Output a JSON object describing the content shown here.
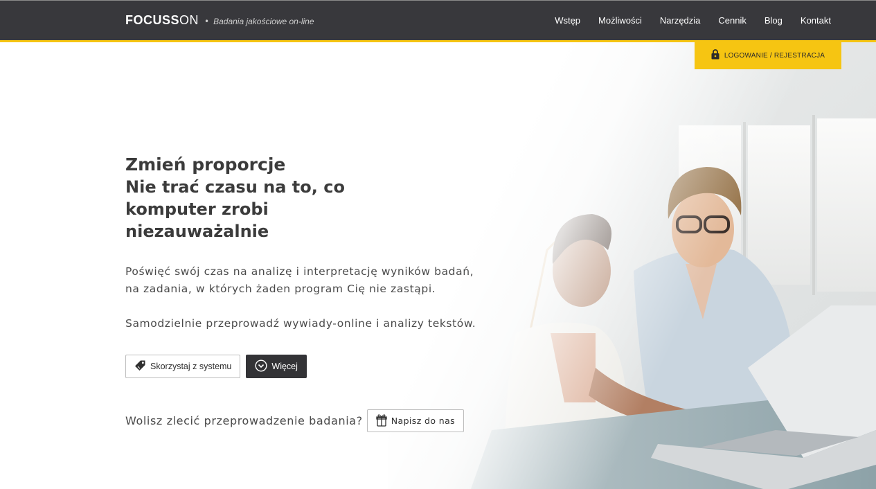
{
  "header": {
    "brand_bold": "FOCUSS",
    "brand_light": "ON",
    "brand_separator": "•",
    "tagline": "Badania jakościowe on-line",
    "nav": [
      {
        "label": "Wstęp"
      },
      {
        "label": "Możliwości"
      },
      {
        "label": "Narzędzia"
      },
      {
        "label": "Cennik"
      },
      {
        "label": "Blog"
      },
      {
        "label": "Kontakt"
      }
    ],
    "login_label": "LOGOWANIE / REJESTRACJA",
    "login_icon": "lock-icon"
  },
  "hero": {
    "headline": "Zmień proporcje",
    "subheadline": "Nie trać czasu na to, co komputer zrobi niezauważalnie",
    "paragraph1": "Poświęć swój czas na analizę i interpretację wyników badań, na zadania, w których żaden program Cię nie zastąpi.",
    "paragraph2": "Samodzielnie przeprowadź wywiady-online i analizy tekstów.",
    "use_system_button": "Skorzystaj z systemu",
    "use_system_icon": "tag-icon",
    "more_button": "Więcej",
    "more_icon": "chevron-circle-down-icon",
    "contact_prompt": "Wolisz zlecić przeprowadzenie badania?",
    "contact_button": "Napisz do nas",
    "contact_icon": "gift-icon"
  },
  "colors": {
    "topbar": "#38383c",
    "accent": "#f6c512",
    "dark_button": "#333336"
  }
}
